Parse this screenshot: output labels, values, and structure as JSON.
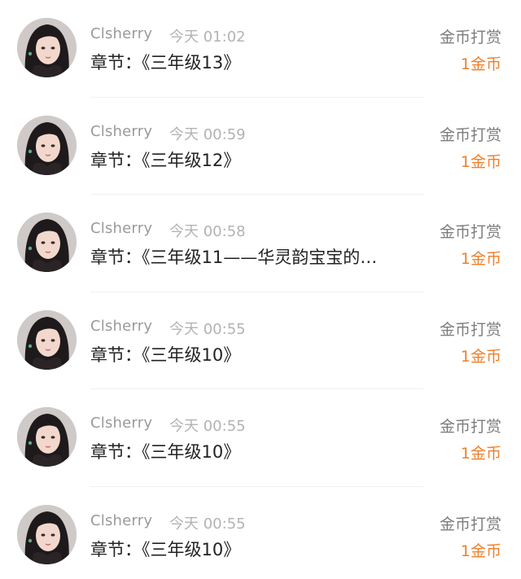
{
  "colors": {
    "username": "#9a9a9a",
    "timestamp": "#b3b3b3",
    "chapter": "#222222",
    "action": "#7d7d7d",
    "amount": "#ef7f2a"
  },
  "records": [
    {
      "username": "Clsherry",
      "time": "今天 01:02",
      "chapter": "章节：《三年级13》",
      "action": "金币打赏",
      "amount": "1金币",
      "avatar_icon": "avatar-icon"
    },
    {
      "username": "Clsherry",
      "time": "今天 00:59",
      "chapter": "章节：《三年级12》",
      "action": "金币打赏",
      "amount": "1金币",
      "avatar_icon": "avatar-icon"
    },
    {
      "username": "Clsherry",
      "time": "今天 00:58",
      "chapter": "章节：《三年级11——华灵韵宝宝的…",
      "action": "金币打赏",
      "amount": "1金币",
      "avatar_icon": "avatar-icon"
    },
    {
      "username": "Clsherry",
      "time": "今天 00:55",
      "chapter": "章节：《三年级10》",
      "action": "金币打赏",
      "amount": "1金币",
      "avatar_icon": "avatar-icon"
    },
    {
      "username": "Clsherry",
      "time": "今天 00:55",
      "chapter": "章节：《三年级10》",
      "action": "金币打赏",
      "amount": "1金币",
      "avatar_icon": "avatar-icon"
    },
    {
      "username": "Clsherry",
      "time": "今天 00:55",
      "chapter": "章节：《三年级10》",
      "action": "金币打赏",
      "amount": "1金币",
      "avatar_icon": "avatar-icon"
    }
  ]
}
